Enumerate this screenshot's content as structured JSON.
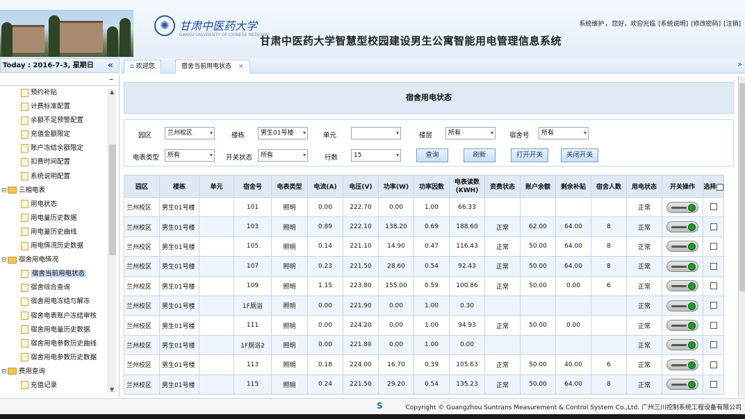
{
  "header": {
    "school_name": "甘肃中医药大学",
    "school_sub": "GANSU UNIVERSITY OF CHINESE MEDICINE",
    "system_title": "甘肃中医药大学智慧型校园建设男生公寓智能用电管理信息系统",
    "top_links": {
      "role": "系统维护",
      "greeting": "您好，欢迎光临",
      "help": "[系统说明]",
      "change_password": "[修改密码]",
      "logout": "[注销]"
    }
  },
  "today": "Today : 2016-7-3, 星期日",
  "tabs": [
    {
      "label": "欢迎您"
    },
    {
      "label": "宿舍当前用电状态"
    }
  ],
  "sidebar": {
    "items": [
      {
        "label": "预约补贴",
        "type": "leaf"
      },
      {
        "label": "计费标准配置",
        "type": "leaf"
      },
      {
        "label": "余额不足预警配置",
        "type": "leaf"
      },
      {
        "label": "充值金额限定",
        "type": "leaf"
      },
      {
        "label": "账户冻结余额限定",
        "type": "leaf"
      },
      {
        "label": "扣费时间配置",
        "type": "leaf"
      },
      {
        "label": "系统说明配置",
        "type": "leaf"
      },
      {
        "label": "三相电表",
        "type": "folder"
      },
      {
        "label": "用电状态",
        "type": "leaf"
      },
      {
        "label": "用电量历史数据",
        "type": "leaf"
      },
      {
        "label": "用电量历史曲线",
        "type": "leaf"
      },
      {
        "label": "用电情况历史数据",
        "type": "leaf"
      },
      {
        "label": "宿舍用电情况",
        "type": "folder"
      },
      {
        "label": "宿舍当前用电状态",
        "type": "leaf",
        "selected": true
      },
      {
        "label": "宿舍综合查询",
        "type": "leaf"
      },
      {
        "label": "宿舍用电冻结与解冻",
        "type": "leaf"
      },
      {
        "label": "宿舍电表账户冻结审核",
        "type": "leaf"
      },
      {
        "label": "宿舍用电量历史数据",
        "type": "leaf"
      },
      {
        "label": "宿舍用电参数历史曲线",
        "type": "leaf"
      },
      {
        "label": "宿舍用电参数历史数据",
        "type": "leaf"
      },
      {
        "label": "费用查询",
        "type": "folder"
      },
      {
        "label": "充值记录",
        "type": "leaf"
      }
    ]
  },
  "panel_title": "宿舍用电状态",
  "filters": {
    "campus_label": "园区",
    "campus_value": "兰州校区",
    "building_label": "楼栋",
    "building_value": "男生01号楼",
    "unit_label": "单元",
    "unit_value": "",
    "floor_label": "楼层",
    "floor_value": "所有",
    "room_label": "宿舍号",
    "room_value": "所有",
    "meter_type_label": "电表类型",
    "meter_type_value": "所有",
    "switch_state_label": "开关状态",
    "switch_state_value": "所有",
    "rows_label": "行数",
    "rows_value": "15",
    "query_button": "查询",
    "refresh_button": "刷新",
    "open_switch_button": "打开开关",
    "close_switch_button": "关闭开关"
  },
  "table": {
    "columns": [
      "园区",
      "楼栋",
      "单元",
      "宿舍号",
      "电表类型",
      "电流(A)",
      "电压(V)",
      "功率(W)",
      "功率因数",
      "电表读数(KWH)",
      "资费状态",
      "账户余额",
      "剩余补贴",
      "宿舍人数",
      "用电状态",
      "开关操作",
      "选择"
    ],
    "rows": [
      [
        "兰州校区",
        "男生01号楼",
        "",
        "101",
        "照明",
        "0.00",
        "222.70",
        "0.00",
        "1.00",
        "66.33",
        "",
        "",
        "",
        "",
        "正常"
      ],
      [
        "兰州校区",
        "男生01号楼",
        "",
        "103",
        "照明",
        "0.89",
        "222.10",
        "138.20",
        "0.69",
        "188.60",
        "正常",
        "62.00",
        "64.00",
        "8",
        "正常"
      ],
      [
        "兰州校区",
        "男生01号楼",
        "",
        "105",
        "照明",
        "0.14",
        "221.10",
        "14.90",
        "0.47",
        "116.43",
        "正常",
        "50.00",
        "64.00",
        "8",
        "正常"
      ],
      [
        "兰州校区",
        "男生01号楼",
        "",
        "107",
        "照明",
        "0.23",
        "221.50",
        "28.60",
        "0.54",
        "92.43",
        "正常",
        "50.00",
        "64.00",
        "8",
        "正常"
      ],
      [
        "兰州校区",
        "男生01号楼",
        "",
        "109",
        "照明",
        "1.15",
        "223.80",
        "155.00",
        "0.59",
        "100.86",
        "正常",
        "50.00",
        "0.00",
        "6",
        "正常"
      ],
      [
        "兰州校区",
        "男生01号楼",
        "",
        "1F厕浴",
        "照明",
        "0.00",
        "221.90",
        "0.00",
        "1.00",
        "0.30",
        "",
        "",
        "",
        "",
        "正常"
      ],
      [
        "兰州校区",
        "男生01号楼",
        "",
        "111",
        "照明",
        "0.00",
        "224.20",
        "0.00",
        "1.00",
        "94.93",
        "正常",
        "50.00",
        "0.00",
        "",
        "正常"
      ],
      [
        "兰州校区",
        "男生01号楼",
        "",
        "1F厕浴2",
        "照明",
        "0.00",
        "221.80",
        "0.00",
        "1.00",
        "0.00",
        "",
        "",
        "",
        "",
        "正常"
      ],
      [
        "兰州校区",
        "男生01号楼",
        "",
        "113",
        "照明",
        "0.18",
        "224.00",
        "16.70",
        "0.39",
        "105.63",
        "正常",
        "50.00",
        "40.00",
        "6",
        "正常"
      ],
      [
        "兰州校区",
        "男生01号楼",
        "",
        "115",
        "照明",
        "0.24",
        "221.50",
        "29.20",
        "0.54",
        "135.23",
        "正常",
        "50.00",
        "64.00",
        "8",
        "正常"
      ]
    ]
  },
  "footer": {
    "copyright": "Copyright © Guangzhou Suntrans Measurement & Control System Co.,Ltd. 广州三川控制系统工程设备有限公司"
  },
  "colors": {
    "accent": "#2a58a2",
    "header_bg": "#dfe9f5",
    "alt_row": "#eef4fb",
    "toggle_on": "#1c9b2c"
  },
  "icons": {
    "collapse": "double-chevron-left-icon",
    "home": "home-icon",
    "expand": "double-chevron-down-icon"
  }
}
